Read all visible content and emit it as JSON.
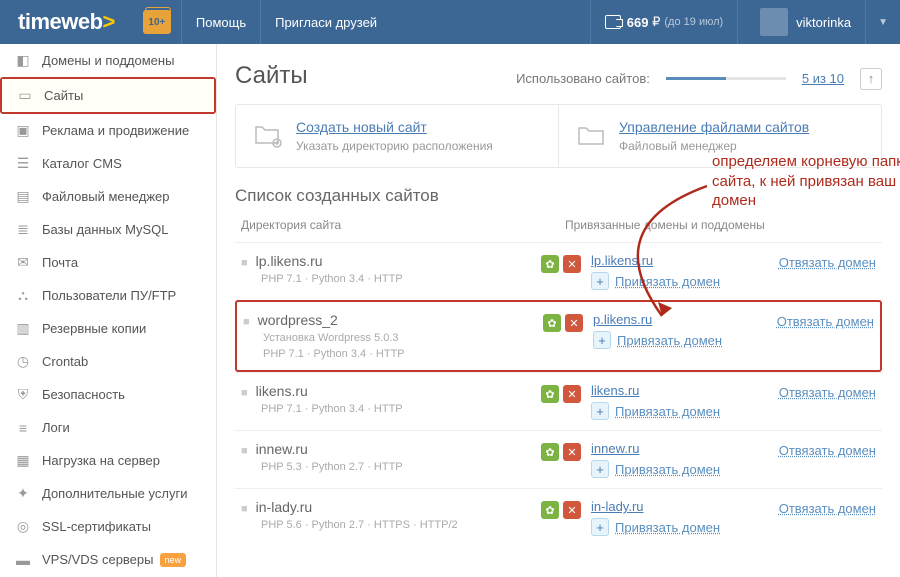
{
  "header": {
    "logo_white": "timeweb",
    "logo_yellow": ">",
    "badge": "10+",
    "help": "Помощь",
    "invite": "Пригласи друзей",
    "balance": "669",
    "currency": "₽",
    "until": "(до 19 июл)",
    "username": "viktorinka"
  },
  "sidebar": [
    {
      "icon": "◧",
      "label": "Домены и поддомены",
      "key": "domains"
    },
    {
      "icon": "▭",
      "label": "Сайты",
      "key": "sites",
      "hi": true,
      "boxed": true
    },
    {
      "icon": "▣",
      "label": "Реклама и продвижение",
      "key": "ads"
    },
    {
      "icon": "☰",
      "label": "Каталог CMS",
      "key": "cms"
    },
    {
      "icon": "▤",
      "label": "Файловый менеджер",
      "key": "files"
    },
    {
      "icon": "≣",
      "label": "Базы данных MySQL",
      "key": "mysql"
    },
    {
      "icon": "✉",
      "label": "Почта",
      "key": "mail"
    },
    {
      "icon": "⛬",
      "label": "Пользователи ПУ/FTP",
      "key": "users"
    },
    {
      "icon": "▥",
      "label": "Резервные копии",
      "key": "backup"
    },
    {
      "icon": "◷",
      "label": "Crontab",
      "key": "cron"
    },
    {
      "icon": "⛨",
      "label": "Безопасность",
      "key": "security"
    },
    {
      "icon": "≡",
      "label": "Логи",
      "key": "logs"
    },
    {
      "icon": "▦",
      "label": "Нагрузка на сервер",
      "key": "load"
    },
    {
      "icon": "✦",
      "label": "Дополнительные услуги",
      "key": "extra"
    },
    {
      "icon": "◎",
      "label": "SSL-сертификаты",
      "key": "ssl"
    },
    {
      "icon": "▬",
      "label": "VPS/VDS серверы",
      "key": "vps",
      "new": "new"
    }
  ],
  "main": {
    "title": "Сайты",
    "usage_label": "Использовано сайтов:",
    "usage_link": "5 из 10",
    "create_title": "Создать новый сайт",
    "create_sub": "Указать директорию расположения",
    "manage_title": "Управление файлами сайтов",
    "manage_sub": "Файловый менеджер",
    "list_title": "Список созданных сайтов",
    "col_dir": "Директория сайта",
    "col_dom": "Привязанные домены и поддомены",
    "bind_label": "Привязать домен",
    "unbind_label": "Отвязать домен",
    "annotation": "определяем корневую папку сайта, к ней привязан ваш домен"
  },
  "sites": [
    {
      "name": "lp.likens.ru",
      "meta": "PHP 7.1 · Python 3.4 · HTTP",
      "domain": "lp.likens.ru"
    },
    {
      "name": "wordpress_2",
      "wp": "Установка Wordpress 5.0.3",
      "meta": "PHP 7.1 · Python 3.4 · HTTP",
      "domain": "p.likens.ru",
      "hi": true
    },
    {
      "name": "likens.ru",
      "meta": "PHP 7.1 · Python 3.4 · HTTP",
      "domain": "likens.ru"
    },
    {
      "name": "innew.ru",
      "meta": "PHP 5.3 · Python 2.7 · HTTP",
      "domain": "innew.ru"
    },
    {
      "name": "in-lady.ru",
      "meta": "PHP 5.6 · Python 2.7 · HTTPS · HTTP/2",
      "domain": "in-lady.ru"
    }
  ]
}
